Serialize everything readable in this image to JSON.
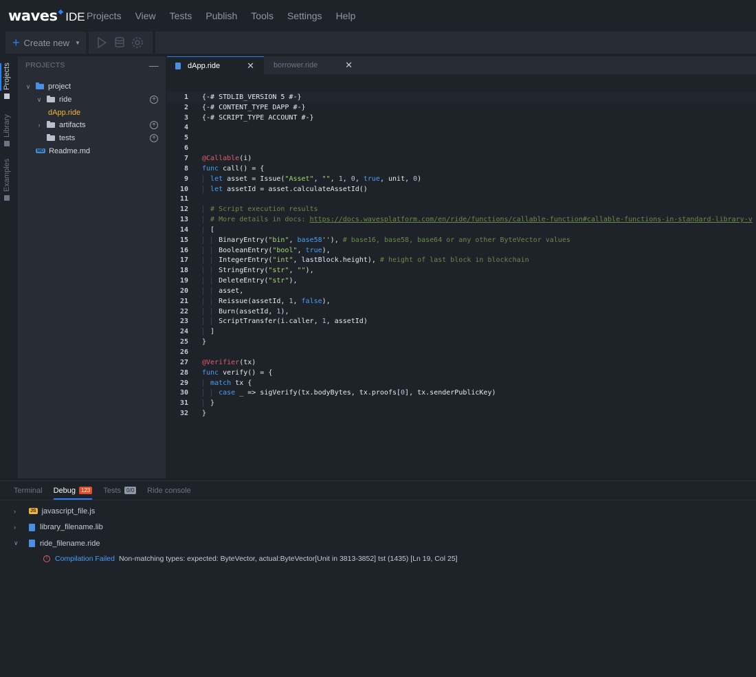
{
  "app": {
    "logo_text": "waves",
    "logo_suffix": "IDE",
    "menu": [
      "Projects",
      "View",
      "Tests",
      "Publish",
      "Tools",
      "Settings",
      "Help"
    ]
  },
  "toolbar": {
    "create_new_label": "Create new",
    "icons": [
      "run-icon",
      "database-icon",
      "settings-icon"
    ]
  },
  "activity_bar": {
    "items": [
      {
        "label": "Projects",
        "icon": "folder-icon",
        "active": true
      },
      {
        "label": "Library",
        "icon": "library-icon",
        "active": false
      },
      {
        "label": "Examples",
        "icon": "examples-icon",
        "active": false
      }
    ]
  },
  "sidebar": {
    "title": "PROJECTS",
    "tree": {
      "project": "project",
      "ride": "ride",
      "dapp": "dApp.ride",
      "artifacts": "artifacts",
      "tests": "tests",
      "md_badge": "MD",
      "readme": "Readme.md"
    }
  },
  "editor": {
    "tabs": [
      {
        "label": "dApp.ride",
        "active": true
      },
      {
        "label": "borrower.ride",
        "active": false
      }
    ],
    "lines": [
      [
        [
          "{-# STDLIB_VERSION 5 #-}",
          "meta"
        ]
      ],
      [
        [
          "{-# CONTENT_TYPE DAPP #-}",
          "meta"
        ]
      ],
      [
        [
          "{-# SCRIPT_TYPE ACCOUNT #-}",
          "meta"
        ]
      ],
      [],
      [],
      [],
      [
        [
          "@Callable",
          "ann"
        ],
        [
          "(i)",
          "plain"
        ]
      ],
      [
        [
          "func",
          "kw"
        ],
        [
          " call() = {",
          "plain"
        ]
      ],
      [
        [
          "  "
        ],
        [
          "let",
          "kw"
        ],
        [
          " asset = Issue(",
          "plain"
        ],
        [
          "\"Asset\"",
          "str"
        ],
        [
          ", ",
          "plain"
        ],
        [
          "\"\"",
          "str"
        ],
        [
          ", ",
          "plain"
        ],
        [
          "1",
          "num"
        ],
        [
          ", ",
          "plain"
        ],
        [
          "0",
          "num"
        ],
        [
          ", ",
          "plain"
        ],
        [
          "true",
          "bool"
        ],
        [
          ", unit, ",
          "plain"
        ],
        [
          "0",
          "num"
        ],
        [
          ")",
          "plain"
        ]
      ],
      [
        [
          "  "
        ],
        [
          "let",
          "kw"
        ],
        [
          " assetId = asset.calculateAssetId()",
          "plain"
        ]
      ],
      [],
      [
        [
          "  "
        ],
        [
          "# Script execution results",
          "com"
        ]
      ],
      [
        [
          "  "
        ],
        [
          "# More details in docs: ",
          "com"
        ],
        [
          "https://docs.wavesplatform.com/en/ride/functions/callable-function#callable-functions-in-standard-library-v",
          "link"
        ]
      ],
      [
        [
          "  "
        ],
        [
          "[",
          "plain"
        ]
      ],
      [
        [
          "    "
        ],
        [
          "BinaryEntry(",
          "plain"
        ],
        [
          "\"bin\"",
          "str"
        ],
        [
          ", ",
          "plain"
        ],
        [
          "base58",
          "kw"
        ],
        [
          "''",
          "str"
        ],
        [
          "), ",
          "plain"
        ],
        [
          "# base16, base58, base64 or any other ByteVector values",
          "com"
        ]
      ],
      [
        [
          "    "
        ],
        [
          "BooleanEntry(",
          "plain"
        ],
        [
          "\"bool\"",
          "str"
        ],
        [
          ", ",
          "plain"
        ],
        [
          "true",
          "bool"
        ],
        [
          "),",
          "plain"
        ]
      ],
      [
        [
          "    "
        ],
        [
          "IntegerEntry(",
          "plain"
        ],
        [
          "\"int\"",
          "str"
        ],
        [
          ", lastBlock.height), ",
          "plain"
        ],
        [
          "# height of last block in blockchain",
          "com"
        ]
      ],
      [
        [
          "    "
        ],
        [
          "StringEntry(",
          "plain"
        ],
        [
          "\"str\"",
          "str"
        ],
        [
          ", ",
          "plain"
        ],
        [
          "\"\"",
          "str"
        ],
        [
          "),",
          "plain"
        ]
      ],
      [
        [
          "    "
        ],
        [
          "DeleteEntry(",
          "plain"
        ],
        [
          "\"str\"",
          "str"
        ],
        [
          "),",
          "plain"
        ]
      ],
      [
        [
          "    "
        ],
        [
          "asset,",
          "plain"
        ]
      ],
      [
        [
          "    "
        ],
        [
          "Reissue(assetId, ",
          "plain"
        ],
        [
          "1",
          "num"
        ],
        [
          ", ",
          "plain"
        ],
        [
          "false",
          "bool"
        ],
        [
          "),",
          "plain"
        ]
      ],
      [
        [
          "    "
        ],
        [
          "Burn(assetId, ",
          "plain"
        ],
        [
          "1",
          "num"
        ],
        [
          "),",
          "plain"
        ]
      ],
      [
        [
          "    "
        ],
        [
          "ScriptTransfer(i.caller, ",
          "plain"
        ],
        [
          "1",
          "num"
        ],
        [
          ", assetId)",
          "plain"
        ]
      ],
      [
        [
          "  "
        ],
        [
          "]",
          "plain"
        ]
      ],
      [
        [
          "}",
          "plain"
        ]
      ],
      [],
      [
        [
          "@Verifier",
          "ann"
        ],
        [
          "(tx)",
          "plain"
        ]
      ],
      [
        [
          "func",
          "kw"
        ],
        [
          " verify() = {",
          "plain"
        ]
      ],
      [
        [
          "  "
        ],
        [
          "match",
          "kw"
        ],
        [
          " tx {",
          "plain"
        ]
      ],
      [
        [
          "    "
        ],
        [
          "case",
          "kw"
        ],
        [
          " _ => sigVerify(tx.bodyBytes, tx.proofs[",
          "plain"
        ],
        [
          "0",
          "num"
        ],
        [
          "], tx.senderPublicKey)",
          "plain"
        ]
      ],
      [
        [
          "  "
        ],
        [
          "}",
          "plain"
        ]
      ],
      [
        [
          "}",
          "plain"
        ]
      ]
    ]
  },
  "panel": {
    "tabs": [
      {
        "label": "Terminal",
        "active": false
      },
      {
        "label": "Debug",
        "active": true,
        "badge": "123"
      },
      {
        "label": "Tests",
        "active": false,
        "badge": "0/0"
      },
      {
        "label": "Ride console",
        "active": false
      }
    ],
    "files": [
      {
        "name": "javascript_file.js",
        "type": "js",
        "badge": "JS",
        "expanded": false
      },
      {
        "name": "library_filename.lib",
        "type": "lib",
        "expanded": false
      },
      {
        "name": "ride_filename.ride",
        "type": "ride",
        "expanded": true
      }
    ],
    "error": {
      "label": "Compilation Failed",
      "message": "Non-matching types: expected: ByteVector, actual:ByteVector[Unit in 3813-3852] tst (1435) [Ln 19, Col 25]"
    }
  },
  "colors": {
    "accent": "#2a7ff5",
    "background": "#1e2229",
    "panel": "#272c35",
    "active_file": "#f5b731",
    "error": "#e35d6a"
  }
}
